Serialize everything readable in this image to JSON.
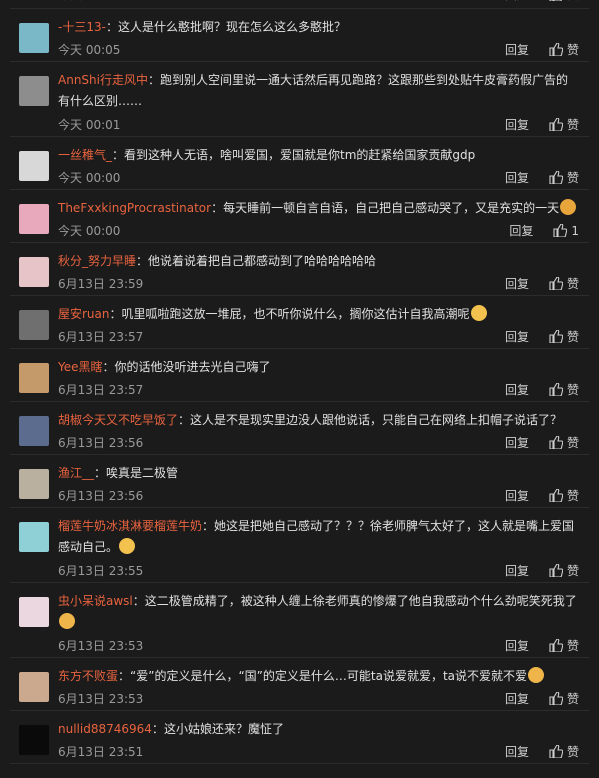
{
  "labels": {
    "reply": "回复",
    "like": "赞"
  },
  "comments": [
    {
      "user": "",
      "text": "",
      "time": "今天 00:00",
      "likes": "",
      "avatar": "#3a3a3a",
      "lines": 0
    },
    {
      "user": "-十三13-",
      "text": "这人是什么憨批啊？现在怎么这么多憨批？",
      "time": "今天 00:05",
      "likes": "",
      "avatar": "#7ab7c7",
      "lines": 1
    },
    {
      "user": "AnnShi行走风中",
      "text": "跑到别人空间里说一通大话然后再见跑路？这跟那些到处贴牛皮膏药假广告的有什么区别……",
      "time": "今天 00:01",
      "likes": "",
      "avatar": "#8d8d8d",
      "lines": 2
    },
    {
      "user": "一丝稚气_",
      "text": "看到这种人无语，啥叫爱国，爱国就是你tm的赶紧给国家贡献gdp",
      "time": "今天 00:00",
      "likes": "",
      "avatar": "#d8d8d8",
      "lines": 1
    },
    {
      "user": "TheFxxkingProcrastinator",
      "text": "每天睡前一顿自言自语，自己把自己感动哭了，又是充实的一天",
      "time": "今天 00:00",
      "likes": "1",
      "avatar": "#e9a9bd",
      "lines": 1,
      "emoji": "#e7a53c"
    },
    {
      "user": "秋分_努力早睡",
      "text": "他说着说着把自己都感动到了哈哈哈哈哈哈",
      "time": "6月13日 23:59",
      "likes": "",
      "avatar": "#e6c4c8",
      "lines": 1
    },
    {
      "user": "屋安ruan",
      "text": "叽里呱啦跑这放一堆屁，也不听你说什么，搁你这估计自我高潮呢",
      "time": "6月13日 23:57",
      "likes": "",
      "avatar": "#6f6f6f",
      "lines": 1,
      "emoji": "#f2c14e"
    },
    {
      "user": "Yee黑瞎",
      "text": "你的话他没听进去光自己嗨了",
      "time": "6月13日 23:57",
      "likes": "",
      "avatar": "#c59a6a",
      "lines": 1
    },
    {
      "user": "胡椒今天又不吃早饭了",
      "text": "这人是不是现实里边没人跟他说话，只能自己在网络上扣帽子说话了？",
      "time": "6月13日 23:56",
      "likes": "",
      "avatar": "#5b6c8f",
      "lines": 1
    },
    {
      "user": "渔江__",
      "text": "唉真是二极管",
      "time": "6月13日 23:56",
      "likes": "",
      "avatar": "#b9b0a0",
      "lines": 1
    },
    {
      "user": "榴莲牛奶冰淇淋要榴莲牛奶",
      "text": "她这是把她自己感动了？？？徐老师脾气太好了，这人就是嘴上爱国感动自己。",
      "time": "6月13日 23:55",
      "likes": "",
      "avatar": "#8fd0d6",
      "lines": 2,
      "emoji": "#f2c14e"
    },
    {
      "user": "虫小呆说awsl",
      "text": "这二极管成精了，被这种人缠上徐老师真的惨爆了他自我感动个什么劲呢笑死我了",
      "time": "6月13日 23:53",
      "likes": "",
      "avatar": "#ead7e0",
      "lines": 2,
      "emoji": "#f0b54a"
    },
    {
      "user": "东方不败蛋",
      "text": "“爱”的定义是什么，“国”的定义是什么…可能ta说爱就爱，ta说不爱就不爱",
      "time": "6月13日 23:53",
      "likes": "",
      "avatar": "#caa98e",
      "lines": 1,
      "emoji": "#f0b54a"
    },
    {
      "user": "nullid88746964",
      "text": "这小姑娘还来？魔怔了",
      "time": "6月13日 23:51",
      "likes": "",
      "avatar": "#0a0a0a",
      "lines": 1
    }
  ]
}
